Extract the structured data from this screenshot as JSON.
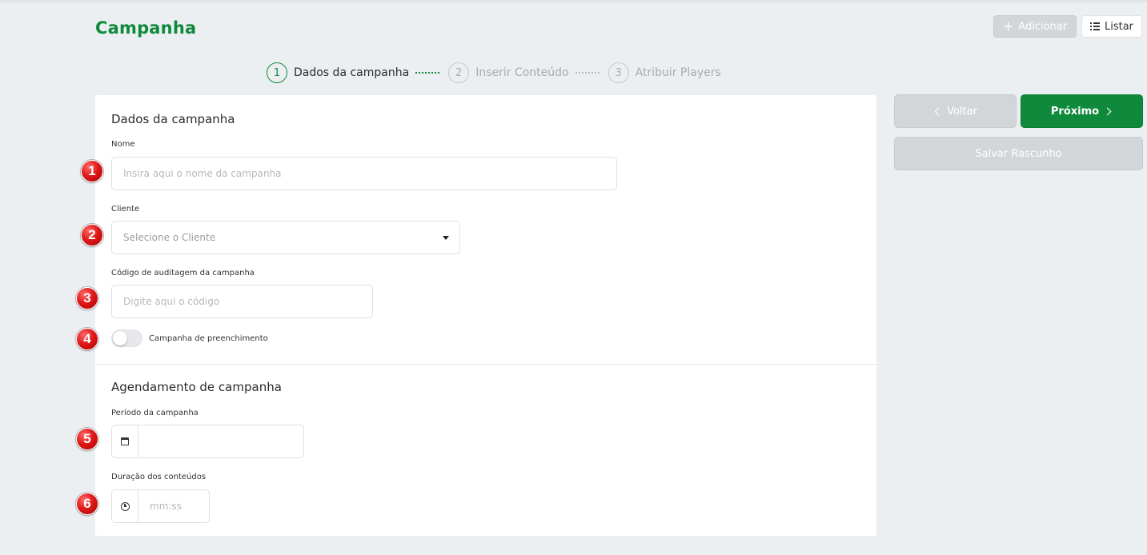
{
  "header": {
    "title": "Campanha",
    "add_label": "Adicionar",
    "list_label": "Listar"
  },
  "stepper": {
    "steps": [
      {
        "number": "1",
        "label": "Dados da campanha",
        "active": true
      },
      {
        "number": "2",
        "label": "Inserir Conteúdo",
        "active": false
      },
      {
        "number": "3",
        "label": "Atribuir Players",
        "active": false
      }
    ]
  },
  "form": {
    "section1_title": "Dados da campanha",
    "name_label": "Nome",
    "name_placeholder": "Insira aqui o nome da campanha",
    "client_label": "Cliente",
    "client_placeholder": "Selecione o Cliente",
    "audit_label": "Código de auditagem da campanha",
    "audit_placeholder": "Digite aqui o código",
    "fill_toggle_label": "Campanha de preenchimento",
    "section2_title": "Agendamento de campanha",
    "period_label": "Período da campanha",
    "period_value": "",
    "duration_label": "Duração dos conteúdos",
    "duration_placeholder": "mm:ss"
  },
  "actions": {
    "back_label": "Voltar",
    "next_label": "Próximo",
    "draft_label": "Salvar Rascunho"
  },
  "annotations": [
    "1",
    "2",
    "3",
    "4",
    "5",
    "6"
  ],
  "colors": {
    "brand_green": "#0f8a3c",
    "disabled_gray": "#d3d6d9",
    "background": "#eceff2",
    "badge_red": "#e01919"
  }
}
